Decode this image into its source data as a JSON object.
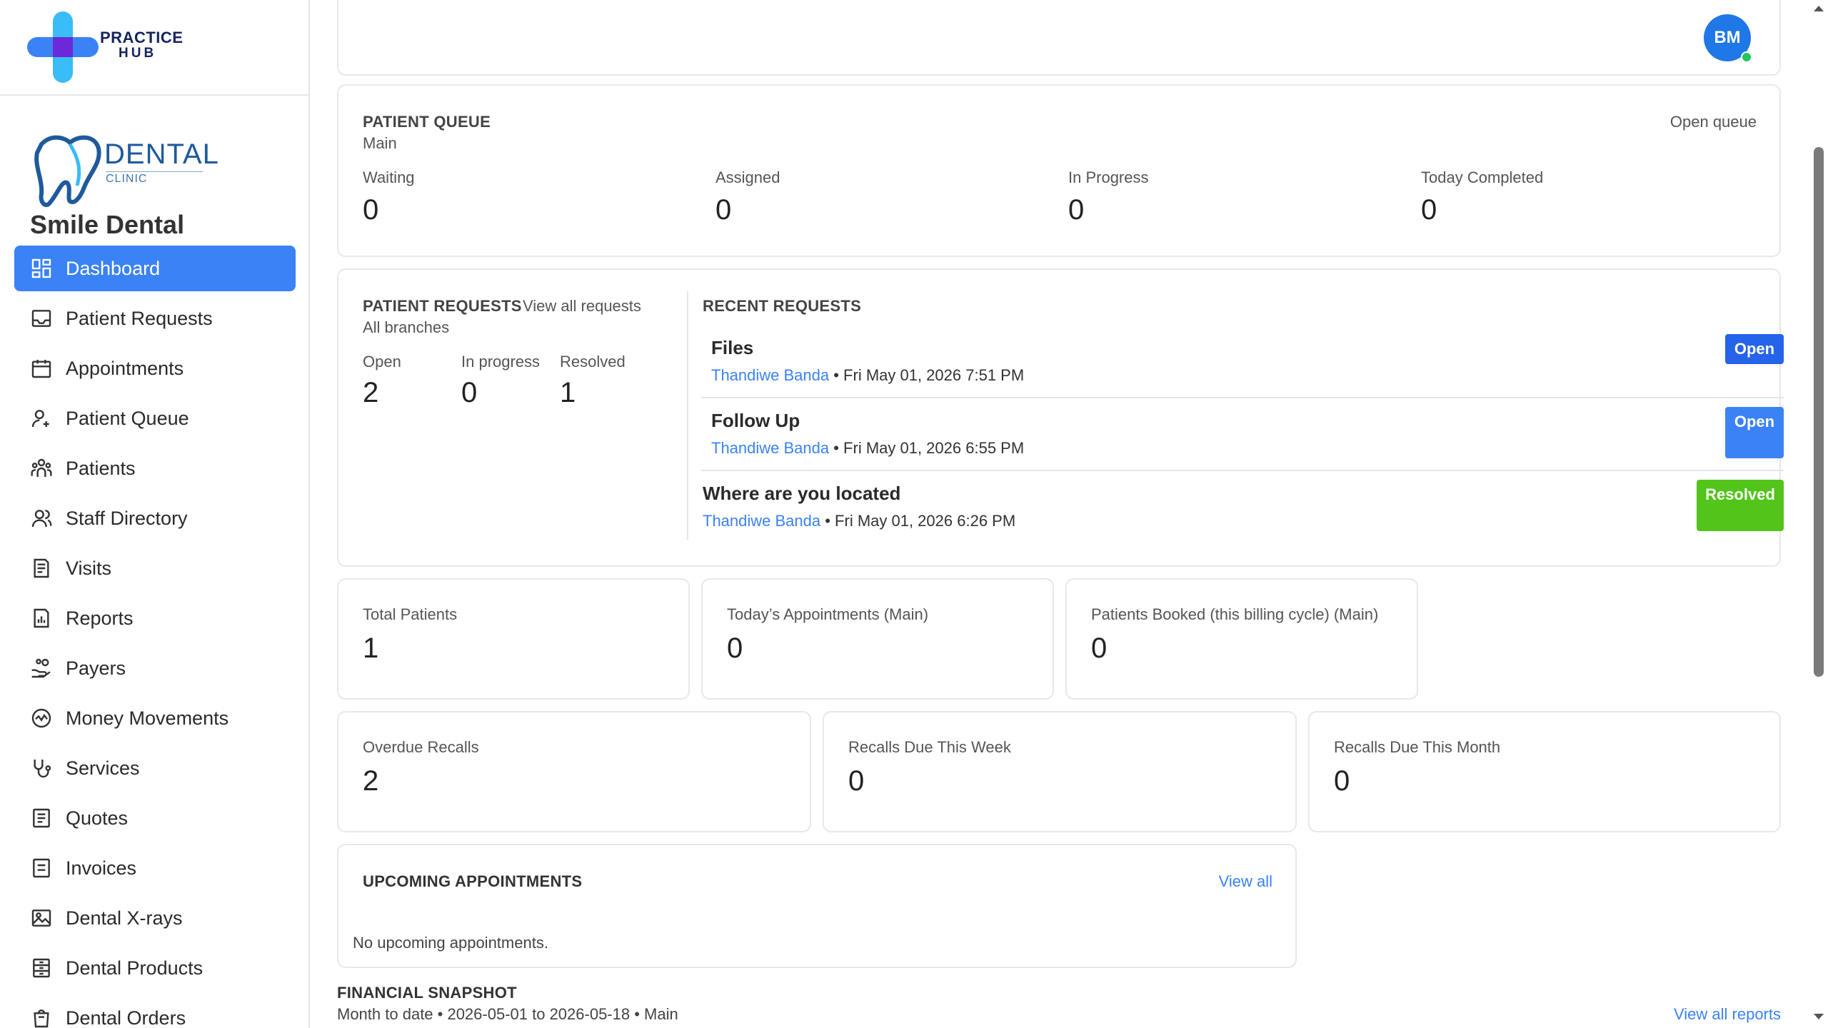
{
  "brand": {
    "line1": "PRACTICE",
    "line2": "HUB"
  },
  "clinic": {
    "logo_word": "DENTAL",
    "logo_sub": "CLINIC",
    "name": "Smile Dental"
  },
  "nav": [
    {
      "label": "Dashboard",
      "icon": "dashboard-icon",
      "active": true
    },
    {
      "label": "Patient Requests",
      "icon": "inbox-icon"
    },
    {
      "label": "Appointments",
      "icon": "calendar-icon"
    },
    {
      "label": "Patient Queue",
      "icon": "user-queue-icon"
    },
    {
      "label": "Patients",
      "icon": "users-icon"
    },
    {
      "label": "Staff Directory",
      "icon": "staff-icon"
    },
    {
      "label": "Visits",
      "icon": "document-icon"
    },
    {
      "label": "Reports",
      "icon": "report-icon"
    },
    {
      "label": "Payers",
      "icon": "hand-coins-icon"
    },
    {
      "label": "Money Movements",
      "icon": "activity-icon"
    },
    {
      "label": "Services",
      "icon": "stethoscope-icon"
    },
    {
      "label": "Quotes",
      "icon": "quote-icon"
    },
    {
      "label": "Invoices",
      "icon": "invoice-icon"
    },
    {
      "label": "Dental X-rays",
      "icon": "image-icon"
    },
    {
      "label": "Dental Products",
      "icon": "product-icon"
    },
    {
      "label": "Dental Orders",
      "icon": "orders-icon"
    }
  ],
  "header": {
    "avatar_initials": "BM"
  },
  "queue": {
    "title": "PATIENT QUEUE",
    "subtitle": "Main",
    "action": "Open queue",
    "stats": [
      {
        "label": "Waiting",
        "value": "0"
      },
      {
        "label": "Assigned",
        "value": "0"
      },
      {
        "label": "In Progress",
        "value": "0"
      },
      {
        "label": "Today Completed",
        "value": "0"
      }
    ]
  },
  "requests": {
    "title": "PATIENT REQUESTS",
    "action": "View all requests",
    "subtitle": "All branches",
    "stats": [
      {
        "label": "Open",
        "value": "2"
      },
      {
        "label": "In progress",
        "value": "0"
      },
      {
        "label": "Resolved",
        "value": "1"
      }
    ],
    "recent_title": "RECENT REQUESTS",
    "recent": [
      {
        "title": "Files",
        "patient": "Thandiwe Banda",
        "meta": " • Fri May 01, 2026 7:51 PM",
        "status": "Open",
        "color": "#2563eb"
      },
      {
        "title": "Follow Up",
        "patient": "Thandiwe Banda",
        "meta": " • Fri May 01, 2026 6:55 PM",
        "status": "Open",
        "color": "#3b82f6"
      },
      {
        "title": "Where are you located",
        "patient": "Thandiwe Banda",
        "meta": " • Fri May 01, 2026 6:26 PM",
        "status": "Resolved",
        "color": "#52c41a"
      }
    ]
  },
  "metrics_row1": [
    {
      "label": "Total Patients",
      "value": "1"
    },
    {
      "label": "Today’s Appointments (Main)",
      "value": "0"
    },
    {
      "label": "Patients Booked (this billing cycle) (Main)",
      "value": "0"
    }
  ],
  "metrics_row2": [
    {
      "label": "Overdue Recalls",
      "value": "2"
    },
    {
      "label": "Recalls Due This Week",
      "value": "0"
    },
    {
      "label": "Recalls Due This Month",
      "value": "0"
    }
  ],
  "upcoming": {
    "title": "UPCOMING APPOINTMENTS",
    "action": "View all",
    "empty": "No upcoming appointments."
  },
  "financial": {
    "title": "FINANCIAL SNAPSHOT",
    "subtitle": "Month to date • 2026-05-01 to 2026-05-18 • Main",
    "action": "View all reports"
  }
}
